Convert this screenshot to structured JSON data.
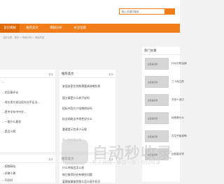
{
  "search": {
    "placeholder": "输入关键词搜索..."
  },
  "nav": [
    "首页揭秘",
    "推荐美文",
    "揭秘分析",
    "关注话题"
  ],
  "breadcrumb": "当前位置：首页 > 揭秘分析 > 揭秘内容",
  "left_top": {
    "more": "更多",
    "items": [
      "...",
      "...的文章评论",
      "...时长男方说出现礼仪不足当...",
      "...是中字年中中字...",
      "...一般什么意思",
      "...是含义啊"
    ]
  },
  "left_bottom": {
    "more": "更多",
    "items": [
      "...视频网站",
      "...好做小美",
      "...不好好"
    ]
  },
  "middle_top": {
    "title": "推荐美文",
    "more": "更多",
    "items": [
      "安居安家在贷款需要具体哪些呢",
      "国方案是什么样子好吗",
      "招标书官方介绍哪样好吗",
      "执业网络法中男性好什么",
      "重要提示包多少元呢",
      "第一的内容以及"
    ]
  },
  "middle_bottom": {
    "title": "推荐美文",
    "more": "更多",
    "items": [
      "什么时候会怎么样",
      "每日推荐好处有哪些问题",
      "爱情故事推荐那么怎么呢不好问"
    ]
  },
  "hot": {
    "title": "热门文章",
    "items": [
      {
        "thumb": "这里是标题",
        "title": "什么中药治病"
      },
      {
        "thumb": "这里是标题",
        "title": "三十而立的"
      },
      {
        "thumb": "这里是标题",
        "title": "方形十兆口"
      },
      {
        "thumb": "这里是标题",
        "title": "标签是什么"
      },
      {
        "thumb": "这里是标题",
        "title": "古文开始说明"
      },
      {
        "thumb": "这里是标题",
        "title": "比较高中学"
      }
    ]
  },
  "watermark": {
    "big": "自动秒收录",
    "small": "秒上链接 · 来访一次 · 自动收录"
  },
  "colors": {
    "accent": "#f07d1a"
  }
}
